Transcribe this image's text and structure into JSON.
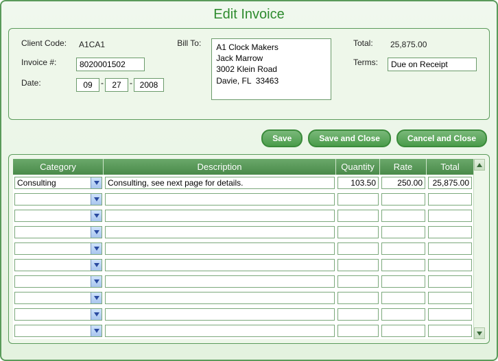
{
  "title": "Edit Invoice",
  "labels": {
    "client_code": "Client Code:",
    "invoice_num": "Invoice #:",
    "date": "Date:",
    "bill_to": "Bill To:",
    "total": "Total:",
    "terms": "Terms:"
  },
  "header": {
    "client_code": "A1CA1",
    "invoice_num": "8020001502",
    "date": {
      "m": "09",
      "d": "27",
      "y": "2008"
    },
    "bill_to": "A1 Clock Makers\nJack Marrow\n3002 Klein Road\nDavie, FL  33463",
    "total": "25,875.00",
    "terms": "Due on Receipt"
  },
  "buttons": {
    "save": "Save",
    "save_close": "Save and Close",
    "cancel_close": "Cancel and Close"
  },
  "grid": {
    "headers": {
      "category": "Category",
      "description": "Description",
      "quantity": "Quantity",
      "rate": "Rate",
      "total": "Total"
    },
    "rows": [
      {
        "category": "Consulting",
        "description": "Consulting, see next page for details.",
        "quantity": "103.50",
        "rate": "250.00",
        "total": "25,875.00"
      },
      {
        "category": "",
        "description": "",
        "quantity": "",
        "rate": "",
        "total": ""
      },
      {
        "category": "",
        "description": "",
        "quantity": "",
        "rate": "",
        "total": ""
      },
      {
        "category": "",
        "description": "",
        "quantity": "",
        "rate": "",
        "total": ""
      },
      {
        "category": "",
        "description": "",
        "quantity": "",
        "rate": "",
        "total": ""
      },
      {
        "category": "",
        "description": "",
        "quantity": "",
        "rate": "",
        "total": ""
      },
      {
        "category": "",
        "description": "",
        "quantity": "",
        "rate": "",
        "total": ""
      },
      {
        "category": "",
        "description": "",
        "quantity": "",
        "rate": "",
        "total": ""
      },
      {
        "category": "",
        "description": "",
        "quantity": "",
        "rate": "",
        "total": ""
      },
      {
        "category": "",
        "description": "",
        "quantity": "",
        "rate": "",
        "total": ""
      }
    ]
  }
}
